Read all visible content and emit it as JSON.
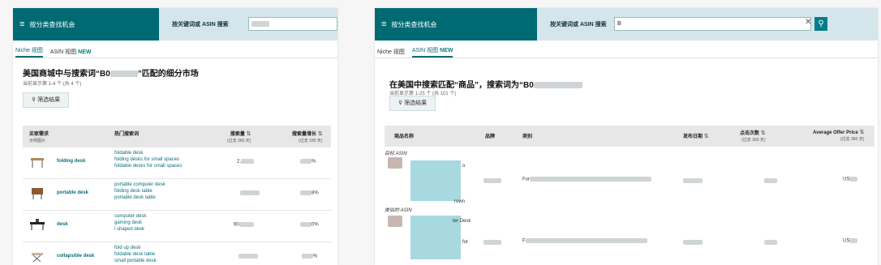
{
  "brand": {
    "title": "按分类查找机会"
  },
  "search": {
    "label": "按关键词或 ASIN 搜索",
    "left_value": "",
    "right_value": "B"
  },
  "left": {
    "tabs": {
      "niche": "Niche 视图",
      "asin": "ASIN 视图",
      "new_badge": "NEW"
    },
    "title_prefix": "美国商城中与搜索词“B0",
    "title_suffix": "”匹配的细分市场",
    "subtitle": "当前显示第 1-4 个 (共 4 个)",
    "filter_label": "筛选结果",
    "headers": {
      "buyer_need": "买家需求",
      "buyer_need_sub": "示例图片",
      "hot_terms": "热门搜索词",
      "volume": "搜索量",
      "volume_sub": "(过去 360 天)",
      "growth": "搜索量增长",
      "growth_sub": "(过去 180 天)"
    },
    "rows": [
      {
        "name": "folding desk",
        "terms": [
          "foldable desk",
          "folding desks for small spaces",
          "foldable desks for small spaces"
        ],
        "volume": "2,",
        "growth": "%"
      },
      {
        "name": "portable desk",
        "terms": [
          "portable computer desk",
          "folding desk table",
          "portable desk table"
        ],
        "volume": "",
        "growth": "8%"
      },
      {
        "name": "desk",
        "terms": [
          "computer desk",
          "gaming desk",
          "l shaped desk"
        ],
        "volume": "90",
        "growth": "0%"
      },
      {
        "name": "collapsible desk",
        "terms": [
          "fold up desk",
          "foldable desk table",
          "small portable desk"
        ],
        "volume": "",
        "growth": "%"
      }
    ]
  },
  "right": {
    "tabs": {
      "niche": "Niche 视图",
      "asin": "ASIN 视图",
      "new_badge": "NEW"
    },
    "title_prefix": "在美国中搜索匹配“商品”，搜索词为“B0",
    "subtitle": "当前显示第 1-25 个 (共 101 个)",
    "filter_label": "筛选结果",
    "headers": {
      "product": "商品名称",
      "brand": "品牌",
      "category": "类别",
      "date": "发布日期",
      "clicks": "点击次数",
      "clicks_sub": "(过去 360 天)",
      "price": "Average Offer Price",
      "price_sub": "(过去 360 天)"
    },
    "groups": [
      {
        "label": "目标 ASIN",
        "category": "Fur",
        "price": "US",
        "frag1": "o",
        "frag2": "rown"
      },
      {
        "label": "类似的 ASIN",
        "category": "F",
        "price": "US",
        "frag1": "ter Desk",
        "frag2": "for"
      }
    ]
  },
  "colors": {
    "teal": "#006a73",
    "search_bg": "#d4e6eb",
    "link": "#0b6e7e"
  }
}
